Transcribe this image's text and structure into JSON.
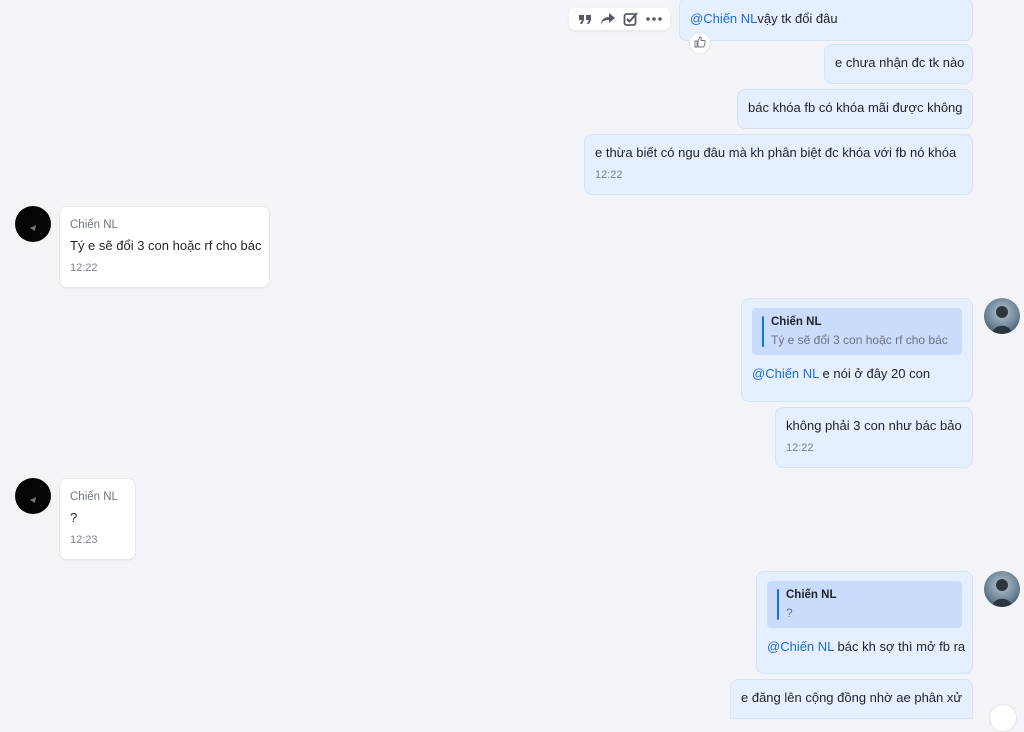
{
  "toolbar": {
    "icons": [
      "quote-icon",
      "forward-icon",
      "task-icon",
      "more-icon"
    ]
  },
  "messages": [
    {
      "mention": "@Chiến NL",
      "text": "vậy tk đổi đâu"
    },
    {
      "text": "e chưa nhận đc tk nào"
    },
    {
      "text": "bác khóa fb có khóa mãi được không"
    },
    {
      "text": "e thừa biết có ngu đâu mà kh phân biệt đc khóa với fb nó khóa",
      "time": "12:22"
    },
    {
      "sender": "Chiến NL",
      "text": "Tý e sẽ đổi 3 con hoặc rf cho bác",
      "time": "12:22"
    },
    {
      "quote": {
        "name": "Chiến NL",
        "text": "Tý e sẽ đổi 3 con hoặc rf cho bác"
      },
      "mention": "@Chiến NL",
      "text": " e nói ở đây 20 con"
    },
    {
      "text": "không phải 3 con như bác bảo",
      "time": "12:22"
    },
    {
      "sender": "Chiến NL",
      "text": "?",
      "time": "12:23"
    },
    {
      "quote": {
        "name": "Chiến NL",
        "text": "?"
      },
      "mention": "@Chiến NL",
      "text": " bác kh sợ thì mở fb ra"
    },
    {
      "text": "e đăng lên cộng đồng nhờ ae phân xử"
    }
  ],
  "colors": {
    "background": "#f2f4f7",
    "outgoing_bubble": "#e5efff",
    "incoming_bubble": "#ffffff",
    "quote_background": "#c9dcfb",
    "mention": "#1a6ee5"
  }
}
